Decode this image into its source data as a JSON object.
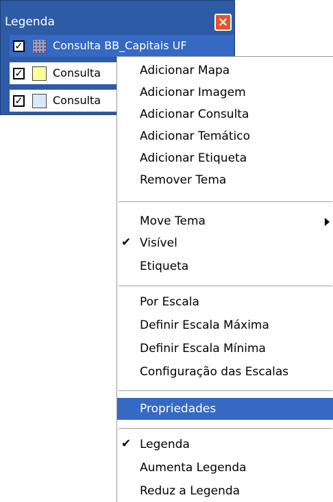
{
  "legend": {
    "title": "Legenda",
    "close_icon": "close-icon",
    "items": [
      {
        "label": "Consulta BB_Capitais UF",
        "checked": true,
        "swatch": "pattern-icon"
      },
      {
        "label": "Consulta",
        "checked": true,
        "swatch_color": "#ffff99"
      },
      {
        "label": "Consulta",
        "checked": true,
        "swatch_color": "#dce8f8"
      }
    ],
    "check_glyph": "✓"
  },
  "context_menu": {
    "group1": [
      "Adicionar Mapa",
      "Adicionar Imagem",
      "Adicionar Consulta",
      "Adicionar Temático",
      "Adicionar Etiqueta",
      "Remover Tema"
    ],
    "group2": [
      {
        "label": "Move Tema",
        "submenu": true
      },
      {
        "label": "Visível",
        "checked": true
      },
      {
        "label": "Etiqueta"
      }
    ],
    "group3": [
      "Por Escala",
      "Definir Escala Máxima",
      "Definir Escala Mínima",
      "Configuração das Escalas"
    ],
    "group4": [
      {
        "label": "Propriedades",
        "highlighted": true
      }
    ],
    "group5": [
      {
        "label": "Legenda",
        "checked": true
      },
      {
        "label": "Aumenta Legenda"
      },
      {
        "label": "Reduz a Legenda"
      }
    ],
    "check_glyph": "✔"
  },
  "colors": {
    "title_bar": "#2e5ba6",
    "highlight": "#3569c3",
    "close": "#e8522c"
  }
}
